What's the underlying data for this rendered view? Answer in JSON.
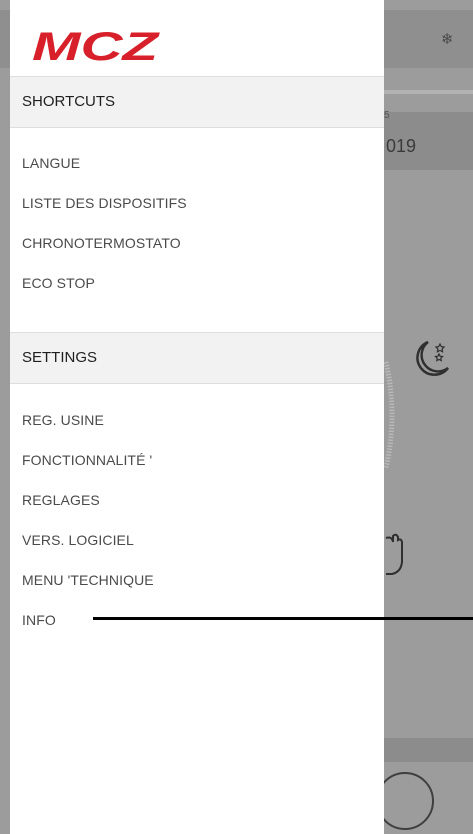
{
  "background": {
    "year_fragment": "019",
    "tick_fragment": "5"
  },
  "drawer": {
    "logo_text": "MCZ",
    "shortcuts": {
      "header": "SHORTCUTS",
      "items": [
        "LANGUE",
        "LISTE DES DISPOSITIFS",
        "CHRONOTERMOSTATO",
        "ECO STOP"
      ]
    },
    "settings": {
      "header": "SETTINGS",
      "items": [
        "REG. USINE",
        "FONCTIONNALITÉ '",
        "REGLAGES",
        "VERS. LOGICIEL",
        "MENU 'TECHNIQUE",
        "INFO"
      ]
    }
  },
  "colors": {
    "brand_red": "#d8202a",
    "overlay_gray": "#9c9c9c"
  },
  "icons": [
    "snowflake-icon",
    "moon-stars-icon",
    "hand-icon"
  ]
}
